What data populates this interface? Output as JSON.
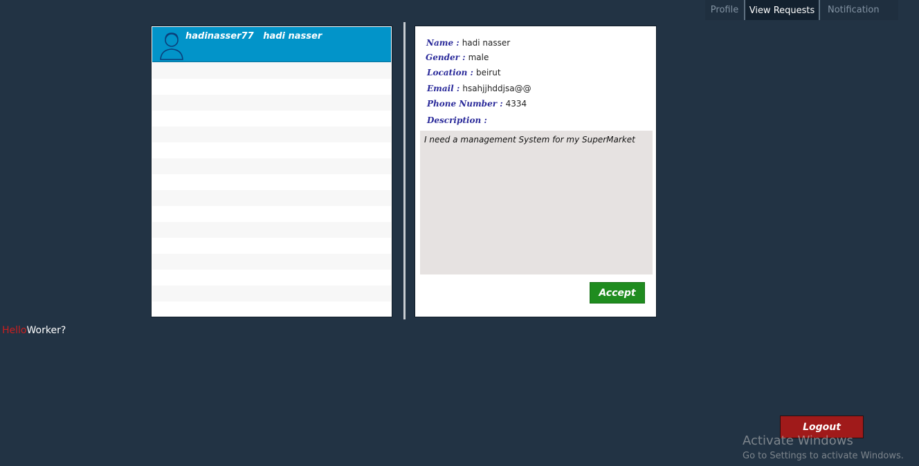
{
  "nav": {
    "tabs": [
      {
        "label": "Profile"
      },
      {
        "label": "View Requests"
      },
      {
        "label": "Notification"
      }
    ]
  },
  "list": {
    "header": {
      "username": "hadinasser77",
      "fullname": "hadi nasser"
    }
  },
  "detail": {
    "name": {
      "label": "Name :",
      "value": "hadi nasser"
    },
    "gender": {
      "label": "Gender :",
      "value": "male"
    },
    "location": {
      "label": "Location :",
      "value": "beirut"
    },
    "email": {
      "label": "Email :",
      "value": "hsahjjhddjsa@@"
    },
    "phone": {
      "label": "Phone Number :",
      "value": "4334"
    },
    "description": {
      "label": "Description :",
      "value": "I need a management System for my SuperMarket"
    },
    "accept_label": "Accept"
  },
  "greeting": {
    "hello": "Hello",
    "rest": "Worker?"
  },
  "logout_label": "Logout",
  "watermark": {
    "title": "Activate Windows",
    "subtitle": "Go to Settings to activate Windows."
  },
  "colors": {
    "background": "#223344",
    "header_blue": "#0294c9",
    "accept_green": "#1f8c1f",
    "logout_red": "#a01a1a",
    "label_blue": "#2a2a9a"
  }
}
